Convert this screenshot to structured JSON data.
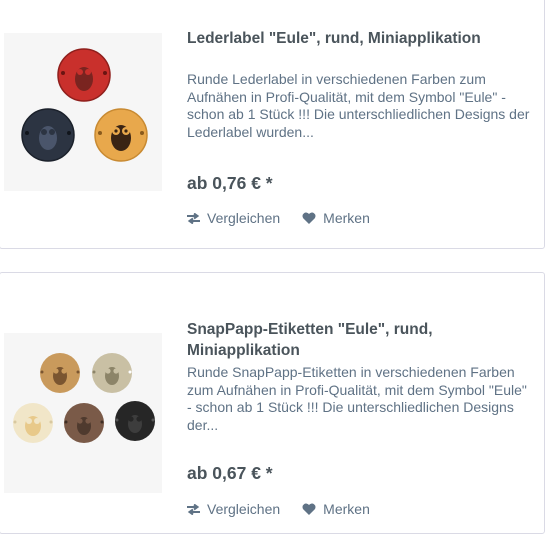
{
  "products": [
    {
      "title": "Lederlabel \"Eule\", rund, Miniapplikation",
      "description": "Runde Lederlabel in verschiedenen Farben zum Aufnähen in Profi-Qualität, mit dem Symbol \"Eule\" - schon ab 1 Stück !!! Die unterschliedlichen Designs der Lederlabel wurden...",
      "price": "ab 0,76 € *",
      "compare_label": "Vergleichen",
      "wishlist_label": "Merken"
    },
    {
      "title": "SnapPapp-Etiketten \"Eule\", rund, Miniapplikation",
      "description": "Runde SnapPapp-Etiketten in verschiedenen Farben zum Aufnähen in Profi-Qualität, mit dem Symbol \"Eule\" - schon ab 1 Stück !!! Die unterschliedlichen Designs der...",
      "price": "ab 0,67 € *",
      "compare_label": "Vergleichen",
      "wishlist_label": "Merken"
    }
  ],
  "colors": {
    "text_dark": "#4a545b",
    "text_muted": "#5f7285",
    "border": "#dadae5",
    "label_colors_leather": [
      "#c9302c",
      "#2c3442",
      "#e4a24a"
    ],
    "label_colors_snappap": [
      "#c99a5c",
      "#c9c0a4",
      "#f1e6c8",
      "#7a5a48",
      "#262626"
    ]
  }
}
